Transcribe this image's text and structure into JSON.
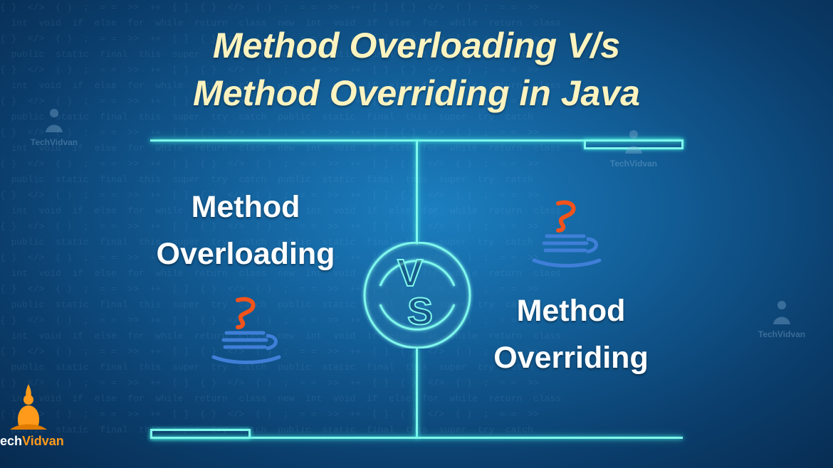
{
  "title": {
    "line1": "Method Overloading V/s",
    "line2": "Method Overriding in Java"
  },
  "left_panel": {
    "line1": "Method",
    "line2": "Overloading",
    "icon": "java-cup-icon"
  },
  "right_panel": {
    "line1": "Method",
    "line2": "Overriding",
    "icon": "java-cup-icon"
  },
  "versus": {
    "letter_v": "V",
    "letter_s": "S"
  },
  "brand": {
    "name": "echVidvan",
    "prefix": "ech",
    "suffix": "Vidvan",
    "watermark": "TechVidvan"
  },
  "colors": {
    "title": "#fdf3bf",
    "glow_line": "#7ff7ec",
    "cup_steam": "#f2531b",
    "cup_body": "#3f7fd8",
    "brand_orange": "#ff9a1a"
  }
}
